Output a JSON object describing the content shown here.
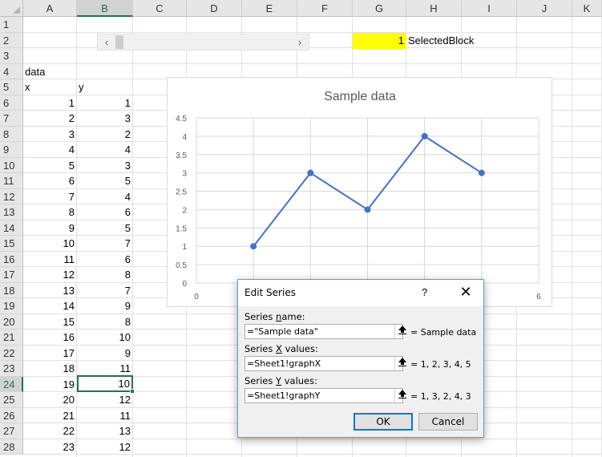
{
  "columns": [
    "A",
    "B",
    "C",
    "D",
    "E",
    "F",
    "G",
    "H",
    "I",
    "J",
    "K"
  ],
  "selected_column": "B",
  "rows": [
    "1",
    "2",
    "3",
    "4",
    "5",
    "6",
    "7",
    "8",
    "9",
    "10",
    "11",
    "12",
    "13",
    "14",
    "15",
    "16",
    "17",
    "18",
    "19",
    "20",
    "21",
    "22",
    "23",
    "24",
    "25",
    "26",
    "27",
    "28"
  ],
  "selected_row": "24",
  "cells": {
    "A4": "data",
    "A5": "x",
    "B5": "y",
    "G2": "1",
    "H2": "SelectedBlock"
  },
  "x_values": [
    "1",
    "2",
    "3",
    "4",
    "5",
    "6",
    "7",
    "8",
    "9",
    "10",
    "11",
    "12",
    "13",
    "14",
    "15",
    "16",
    "17",
    "18",
    "19",
    "20",
    "21",
    "22",
    "23"
  ],
  "y_values": [
    "1",
    "3",
    "2",
    "4",
    "3",
    "5",
    "4",
    "6",
    "5",
    "7",
    "6",
    "8",
    "7",
    "9",
    "8",
    "10",
    "9",
    "11",
    "10",
    "12",
    "11",
    "13",
    "12"
  ],
  "active_cell_value": "10",
  "scrollbar": {
    "left_arrow": "‹",
    "right_arrow": "›",
    "position_fraction": 0.0
  },
  "highlight_color": "#ffff00",
  "chart_data": {
    "type": "line",
    "title": "Sample data",
    "x": [
      1,
      2,
      3,
      4,
      5
    ],
    "series": [
      {
        "values": [
          1,
          3,
          2,
          4,
          3
        ],
        "color": "#4472c4"
      }
    ],
    "ylim": [
      0,
      4.5
    ],
    "xlim": [
      0,
      6
    ],
    "y_ticks": [
      "0",
      "0.5",
      "1",
      "1.5",
      "2",
      "2.5",
      "3",
      "3.5",
      "4",
      "4.5"
    ],
    "x_tick_labels_visible": [
      "0",
      "6"
    ],
    "grid": true
  },
  "dialog": {
    "title": "Edit Series",
    "help": "?",
    "close": "✕",
    "series_name_label_pre": "Series ",
    "series_name_label_u": "n",
    "series_name_label_post": "ame:",
    "series_name_value": "=\"Sample data\"",
    "series_name_result": "= Sample data",
    "series_x_label_pre": "Series ",
    "series_x_label_u": "X",
    "series_x_label_post": " values:",
    "series_x_value": "=Sheet1!graphX",
    "series_x_result": "= 1, 2, 3, 4, 5",
    "series_y_label_pre": "Series ",
    "series_y_label_u": "Y",
    "series_y_label_post": " values:",
    "series_y_value": "=Sheet1!graphY",
    "series_y_result": "= 1, 3, 2, 4, 3",
    "ok_label": "OK",
    "cancel_label": "Cancel",
    "ref_icon": "collapse-dialog-icon"
  }
}
